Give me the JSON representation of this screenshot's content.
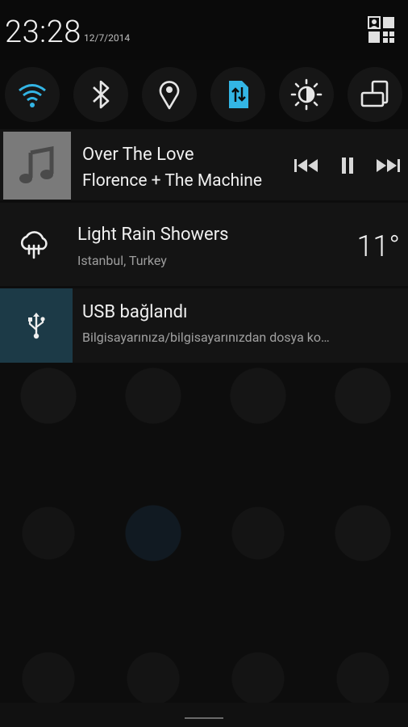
{
  "status_bar": {
    "time": "23:28",
    "date": "12/7/2014"
  },
  "quick_toggles": [
    {
      "name": "wifi",
      "active": true
    },
    {
      "name": "bluetooth",
      "active": false
    },
    {
      "name": "location",
      "active": false
    },
    {
      "name": "data",
      "active": true
    },
    {
      "name": "brightness",
      "active": false
    },
    {
      "name": "auto-rotate",
      "active": false
    }
  ],
  "media": {
    "title": "Over The Love",
    "artist": "Florence + The Machine"
  },
  "weather": {
    "condition": "Light Rain Showers",
    "location": "Istanbul, Turkey",
    "temperature": "11°"
  },
  "usb": {
    "title": "USB bağlandı",
    "message": "Bilgisayarınıza/bilgisayarınızdan dosya ko…"
  },
  "colors": {
    "accent": "#33b5e5",
    "usb_bg": "#1c3a47",
    "panel": "#141414"
  }
}
